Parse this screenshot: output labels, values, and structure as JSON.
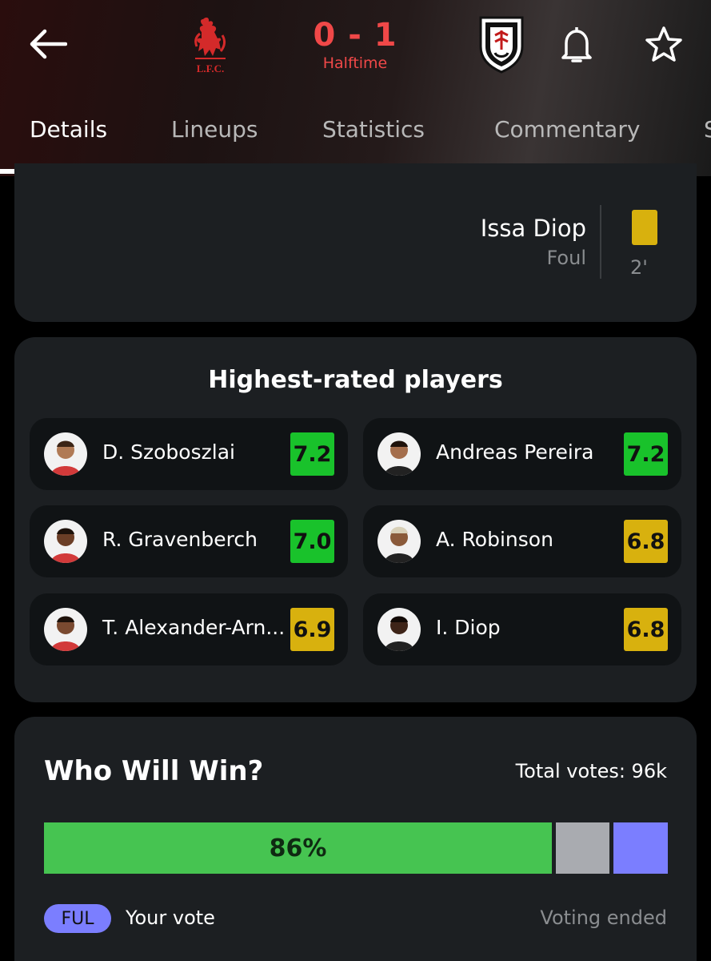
{
  "header": {
    "home_team": {
      "logo_text": "L.F.C.",
      "logo_icon": "liverpool-crest-icon"
    },
    "away_team": {
      "logo_icon": "fulham-crest-icon"
    },
    "score": "0 - 1",
    "status": "Halftime",
    "accent_color": "#f04848"
  },
  "tabs": [
    {
      "label": "Details",
      "active": true
    },
    {
      "label": "Lineups"
    },
    {
      "label": "Statistics"
    },
    {
      "label": "Commentary"
    },
    {
      "label": "S"
    }
  ],
  "event": {
    "player": "Issa Diop",
    "reason": "Foul",
    "card": "yellow",
    "minute": "2'"
  },
  "highest_rated": {
    "title": "Highest-rated players",
    "home": [
      {
        "name": "D. Szoboszlai",
        "rating": "7.2",
        "tier": "green"
      },
      {
        "name": "R. Gravenberch",
        "rating": "7.0",
        "tier": "green"
      },
      {
        "name": "T. Alexander-Arn...",
        "rating": "6.9",
        "tier": "yellow"
      }
    ],
    "away": [
      {
        "name": "Andreas Pereira",
        "rating": "7.2",
        "tier": "green"
      },
      {
        "name": "A. Robinson",
        "rating": "6.8",
        "tier": "yellow"
      },
      {
        "name": "I. Diop",
        "rating": "6.8",
        "tier": "yellow"
      }
    ],
    "colors": {
      "green": "#19c22b",
      "yellow": "#d8b10e"
    }
  },
  "vote": {
    "title": "Who Will Win?",
    "total": "Total votes: 96k",
    "home_pct_label": "86%",
    "home_fraction": 0.86,
    "badge": "FUL",
    "your_vote": "Your vote",
    "status": "Voting ended",
    "colors": {
      "home": "#46c451",
      "draw": "#a9abb0",
      "away": "#7b7eff"
    }
  }
}
